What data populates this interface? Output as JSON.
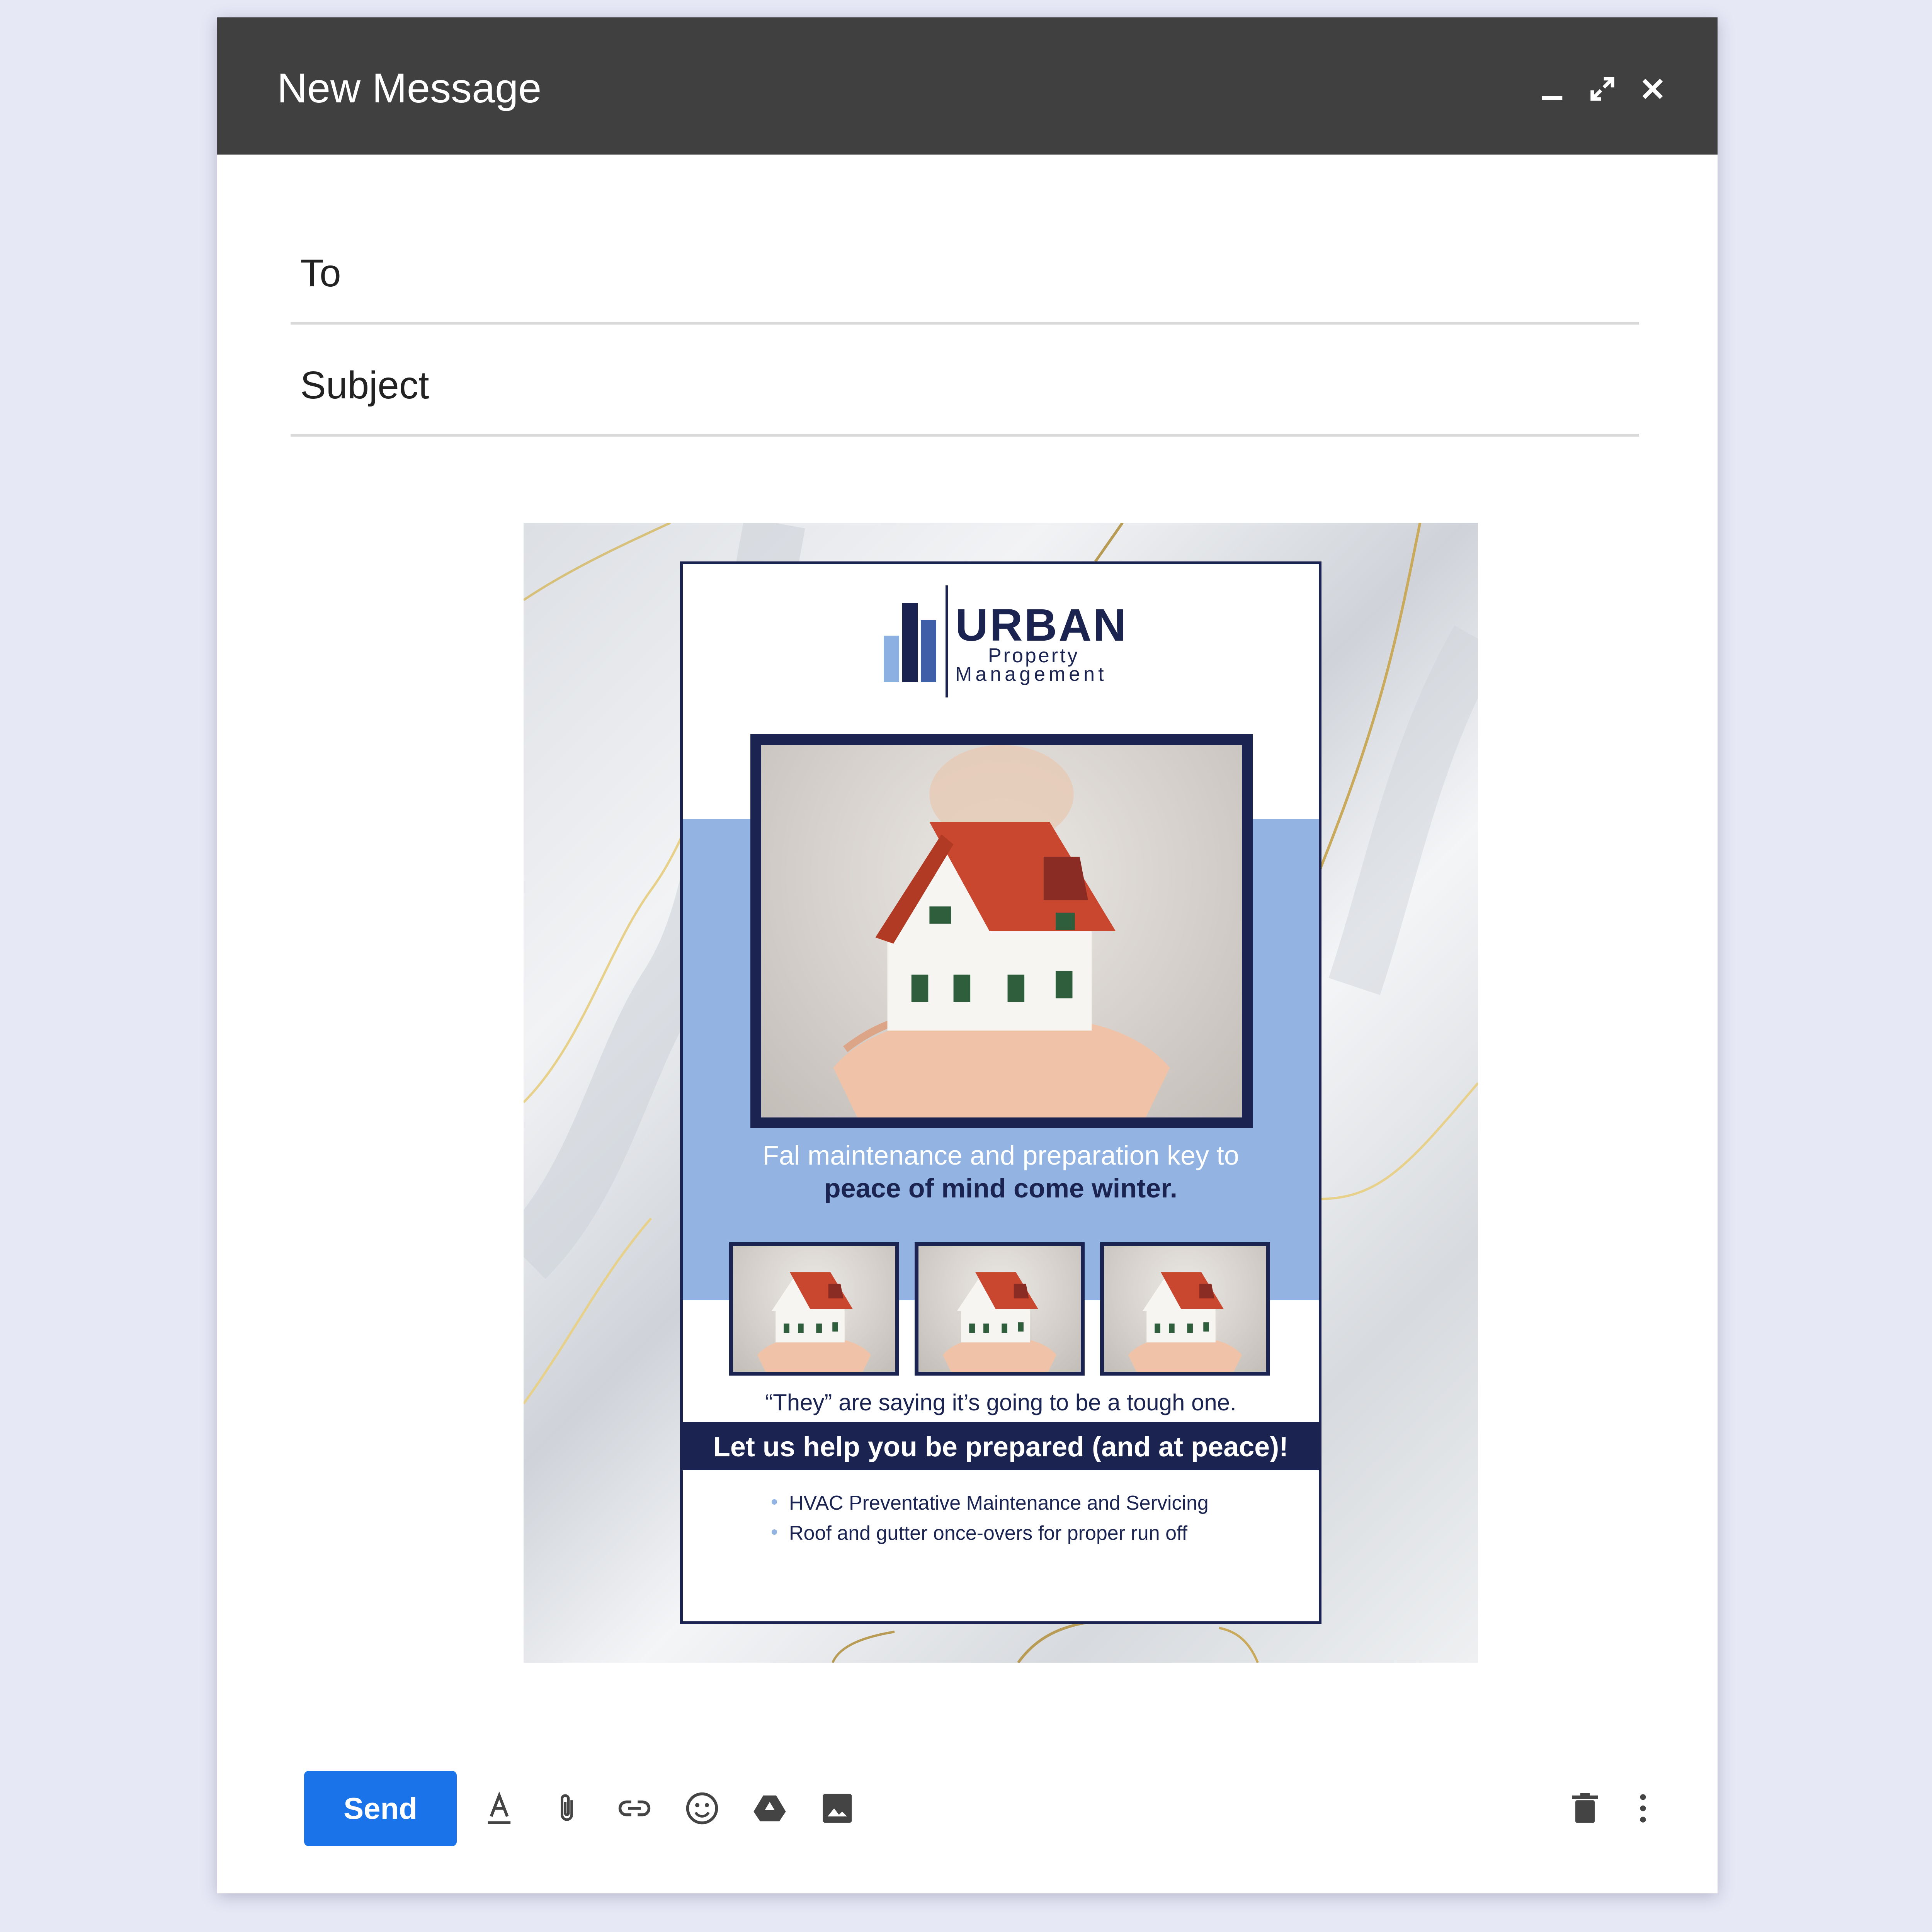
{
  "window": {
    "title": "New Message"
  },
  "fields": {
    "to_label": "To",
    "subject_label": "Subject"
  },
  "flyer": {
    "brand": {
      "name": "URBAN",
      "line1": "Property",
      "line2": "Management"
    },
    "headline_light": "Fal maintenance and preparation key to",
    "headline_bold": "peace of mind come winter.",
    "saying": "“They” are saying it’s going to be a tough one.",
    "cta": "Let us help you be prepared (and at peace)!",
    "bullets": [
      "HVAC Preventative Maintenance and Servicing",
      "Roof and gutter once-overs for proper run off"
    ]
  },
  "toolbar": {
    "send_label": "Send",
    "tools": [
      "format-text-icon",
      "attach-icon",
      "link-icon",
      "emoji-icon",
      "drive-icon",
      "photo-icon"
    ],
    "right_tools": [
      "trash-icon",
      "more-options-icon"
    ]
  },
  "colors": {
    "titlebar": "#404040",
    "navy": "#1b2350",
    "accent_blue": "#93b4e2",
    "send": "#1a73e8"
  }
}
